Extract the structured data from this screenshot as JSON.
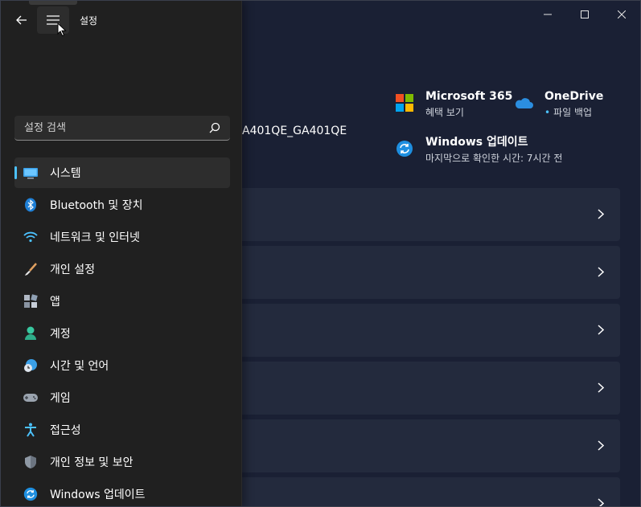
{
  "window": {
    "controls": [
      {
        "name": "minimize",
        "icon": "minimize-icon"
      },
      {
        "name": "maximize",
        "icon": "maximize-icon"
      },
      {
        "name": "close",
        "icon": "close-icon"
      }
    ]
  },
  "header": {
    "app_title": "설정",
    "back_icon": "back-arrow-icon",
    "menu_icon": "hamburger-menu-icon"
  },
  "search": {
    "placeholder": "설정 검색",
    "icon": "search-icon"
  },
  "nav": {
    "selected_index": 0,
    "accent": "#4cc2ff",
    "items": [
      {
        "label": "시스템",
        "icon": "system-display-icon"
      },
      {
        "label": "Bluetooth 및 장치",
        "icon": "bluetooth-icon"
      },
      {
        "label": "네트워크 및 인터넷",
        "icon": "wifi-icon"
      },
      {
        "label": "개인 설정",
        "icon": "paintbrush-icon"
      },
      {
        "label": "앱",
        "icon": "apps-icon"
      },
      {
        "label": "계정",
        "icon": "account-icon"
      },
      {
        "label": "시간 및 언어",
        "icon": "time-language-icon"
      },
      {
        "label": "게임",
        "icon": "gamepad-icon"
      },
      {
        "label": "접근성",
        "icon": "accessibility-icon"
      },
      {
        "label": "개인 정보 및 보안",
        "icon": "shield-icon"
      },
      {
        "label": "Windows 업데이트",
        "icon": "windows-update-icon"
      }
    ]
  },
  "main": {
    "device_name_partial": "A401QE_GA401QE",
    "quick_links": {
      "ms365": {
        "title": "Microsoft 365",
        "subtitle": "혜택 보기",
        "icon": "microsoft-logo-icon"
      },
      "onedrive": {
        "title": "OneDrive",
        "subtitle": "파일 백업",
        "icon": "onedrive-cloud-icon"
      },
      "update": {
        "title": "Windows 업데이트",
        "subtitle": "마지막으로 확인한 시간: 7시간 전",
        "icon": "windows-update-icon"
      }
    },
    "cards_count": 6
  }
}
